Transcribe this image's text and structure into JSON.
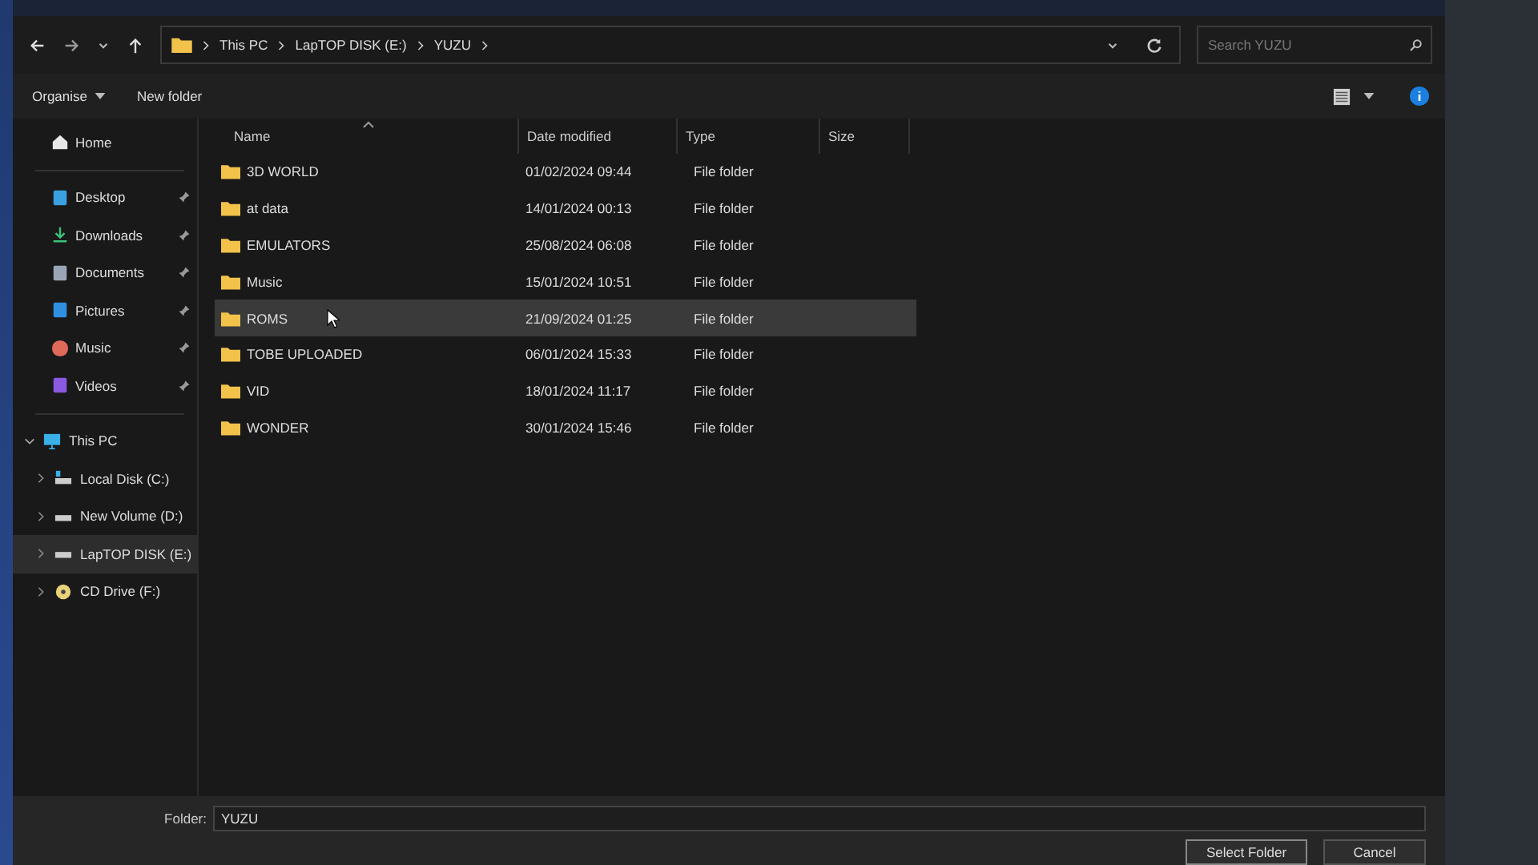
{
  "nav": {
    "breadcrumb": [
      "This PC",
      "LapTOP DISK (E:)",
      "YUZU"
    ],
    "search": {
      "placeholder": "Search YUZU"
    }
  },
  "command_bar": {
    "organise": "Organise",
    "new_folder": "New folder"
  },
  "sidebar": {
    "quick_access": [
      {
        "label": "Home",
        "kind": "home",
        "pinned": false
      },
      {
        "label": "Desktop",
        "kind": "desktop",
        "pinned": true
      },
      {
        "label": "Downloads",
        "kind": "downloads",
        "pinned": true
      },
      {
        "label": "Documents",
        "kind": "documents",
        "pinned": true
      },
      {
        "label": "Pictures",
        "kind": "pictures",
        "pinned": true
      },
      {
        "label": "Music",
        "kind": "music",
        "pinned": true
      },
      {
        "label": "Videos",
        "kind": "videos",
        "pinned": true
      }
    ],
    "tree": [
      {
        "label": "This PC",
        "kind": "pc",
        "expanded": true,
        "selected": false,
        "children": [
          {
            "label": "Local Disk (C:)",
            "kind": "system-disk",
            "expanded": false,
            "selected": false
          },
          {
            "label": "New Volume (D:)",
            "kind": "disk",
            "expanded": false,
            "selected": false
          },
          {
            "label": "LapTOP DISK (E:)",
            "kind": "disk",
            "expanded": false,
            "selected": true
          },
          {
            "label": "CD Drive (F:)",
            "kind": "cd",
            "expanded": false,
            "selected": false
          }
        ]
      }
    ]
  },
  "table": {
    "columns": [
      {
        "label": "Name",
        "sorted": true
      },
      {
        "label": "Date modified",
        "sorted": false
      },
      {
        "label": "Type",
        "sorted": false
      },
      {
        "label": "Size",
        "sorted": false
      }
    ],
    "rows": [
      {
        "name": "3D WORLD",
        "date": "01/02/2024 09:44",
        "type": "File folder",
        "selected": false
      },
      {
        "name": "at data",
        "date": "14/01/2024 00:13",
        "type": "File folder",
        "selected": false
      },
      {
        "name": "EMULATORS",
        "date": "25/08/2024 06:08",
        "type": "File folder",
        "selected": false
      },
      {
        "name": "Music",
        "date": "15/01/2024 10:51",
        "type": "File folder",
        "selected": false
      },
      {
        "name": "ROMS",
        "date": "21/09/2024 01:25",
        "type": "File folder",
        "selected": true
      },
      {
        "name": "TOBE UPLOADED",
        "date": "06/01/2024 15:33",
        "type": "File folder",
        "selected": false
      },
      {
        "name": "VID",
        "date": "18/01/2024 11:17",
        "type": "File folder",
        "selected": false
      },
      {
        "name": "WONDER",
        "date": "30/01/2024 15:46",
        "type": "File folder",
        "selected": false
      }
    ]
  },
  "footer": {
    "folder_label": "Folder:",
    "folder_value": "YUZU",
    "buttons": [
      "Select Folder",
      "Cancel"
    ]
  }
}
